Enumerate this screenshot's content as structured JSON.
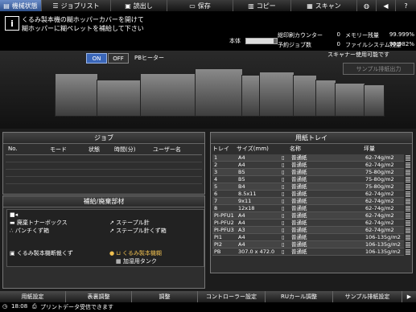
{
  "top_tabs": [
    {
      "label": "機械状態",
      "icon": "machine-icon"
    },
    {
      "label": "ジョブリスト",
      "icon": "list-icon"
    },
    {
      "label": "読出し",
      "icon": "folder-icon"
    },
    {
      "label": "保存",
      "icon": "save-icon"
    },
    {
      "label": "コピー",
      "icon": "copy-icon"
    },
    {
      "label": "スキャン",
      "icon": "scan-icon"
    }
  ],
  "message": {
    "line1": "くるみ製本機の糊ホッパーカバーを開けて",
    "line2": "糊ホッパーに糊ペレットを補給して下さい"
  },
  "counters": {
    "total_label": "総印刷カウンター",
    "total_value": "0",
    "memory_label": "メモリー残量",
    "memory_value": "99.999%",
    "job_label": "予約ジョブ数",
    "job_value": "0",
    "filesystem_label": "ファイルシステム残量",
    "filesystem_value": "99.982%",
    "main_unit_label": "本体"
  },
  "machine": {
    "on_label": "ON",
    "off_label": "OFF",
    "pb_heater_label": "PBヒーター",
    "scanner_status": "スキャナー使用可能です",
    "sample_button": "サンプル排紙出力"
  },
  "job_panel": {
    "title": "ジョブ",
    "headers": [
      "No.",
      "モード",
      "状態",
      "時間(分)",
      "ユーザー名"
    ]
  },
  "supply_panel": {
    "title": "補給/廃棄部材",
    "items": [
      {
        "icon": "waste-toner-icon",
        "label": "廃棄トナーボックス"
      },
      {
        "icon": "punch-icon",
        "label": "パンチくず箱"
      },
      {
        "icon": "staple-icon",
        "label": "ステープル針"
      },
      {
        "icon": "staple-waste-icon",
        "label": "ステープル針くず箱"
      },
      {
        "icon": "trim-icon",
        "label": "くるみ製本機断裁くず"
      },
      {
        "icon": "glue-icon",
        "label": "くるみ製本機糊"
      },
      {
        "icon": "humidifier-icon",
        "label": "加湿用タンク"
      }
    ]
  },
  "tray_panel": {
    "title": "用紙トレイ",
    "headers": [
      "トレイ",
      "サイズ(mm)",
      "名称",
      "坪量"
    ],
    "rows": [
      {
        "tray": "1",
        "size": "A4",
        "name": "普通紙",
        "weight": "62-74g/m2"
      },
      {
        "tray": "2",
        "size": "A4",
        "name": "普通紙",
        "weight": "62-74g/m2"
      },
      {
        "tray": "3",
        "size": "B5",
        "name": "普通紙",
        "weight": "75-80g/m2"
      },
      {
        "tray": "4",
        "size": "B5",
        "name": "普通紙",
        "weight": "75-80g/m2"
      },
      {
        "tray": "5",
        "size": "B4",
        "name": "普通紙",
        "weight": "75-80g/m2"
      },
      {
        "tray": "6",
        "size": "8.5x11",
        "name": "普通紙",
        "weight": "62-74g/m2"
      },
      {
        "tray": "7",
        "size": "9x11",
        "name": "普通紙",
        "weight": "62-74g/m2"
      },
      {
        "tray": "8",
        "size": "12x18",
        "name": "普通紙",
        "weight": "62-74g/m2"
      },
      {
        "tray": "PI-PFU1",
        "size": "A4",
        "name": "普通紙",
        "weight": "62-74g/m2"
      },
      {
        "tray": "PI-PFU2",
        "size": "A4",
        "name": "普通紙",
        "weight": "62-74g/m2"
      },
      {
        "tray": "PI-PFU3",
        "size": "A3",
        "name": "普通紙",
        "weight": "62-74g/m2"
      },
      {
        "tray": "PI1",
        "size": "A4",
        "name": "普通紙",
        "weight": "106-135g/m2"
      },
      {
        "tray": "PI2",
        "size": "A4",
        "name": "普通紙",
        "weight": "106-135g/m2"
      },
      {
        "tray": "PB",
        "size": "307.0 x 472.0",
        "name": "普通紙",
        "weight": "106-135g/m2"
      }
    ]
  },
  "bottom_tabs": [
    "用紙設定",
    "表裏調整",
    "調整",
    "コントローラー設定",
    "RUカール調整",
    "サンプル排紙設定"
  ],
  "status": {
    "time": "18:08",
    "message": "プリントデータ受信できます"
  },
  "colors": {
    "accent": "#3a66b8",
    "panel": "#2e2e2e",
    "background": "#1c1c1c"
  }
}
